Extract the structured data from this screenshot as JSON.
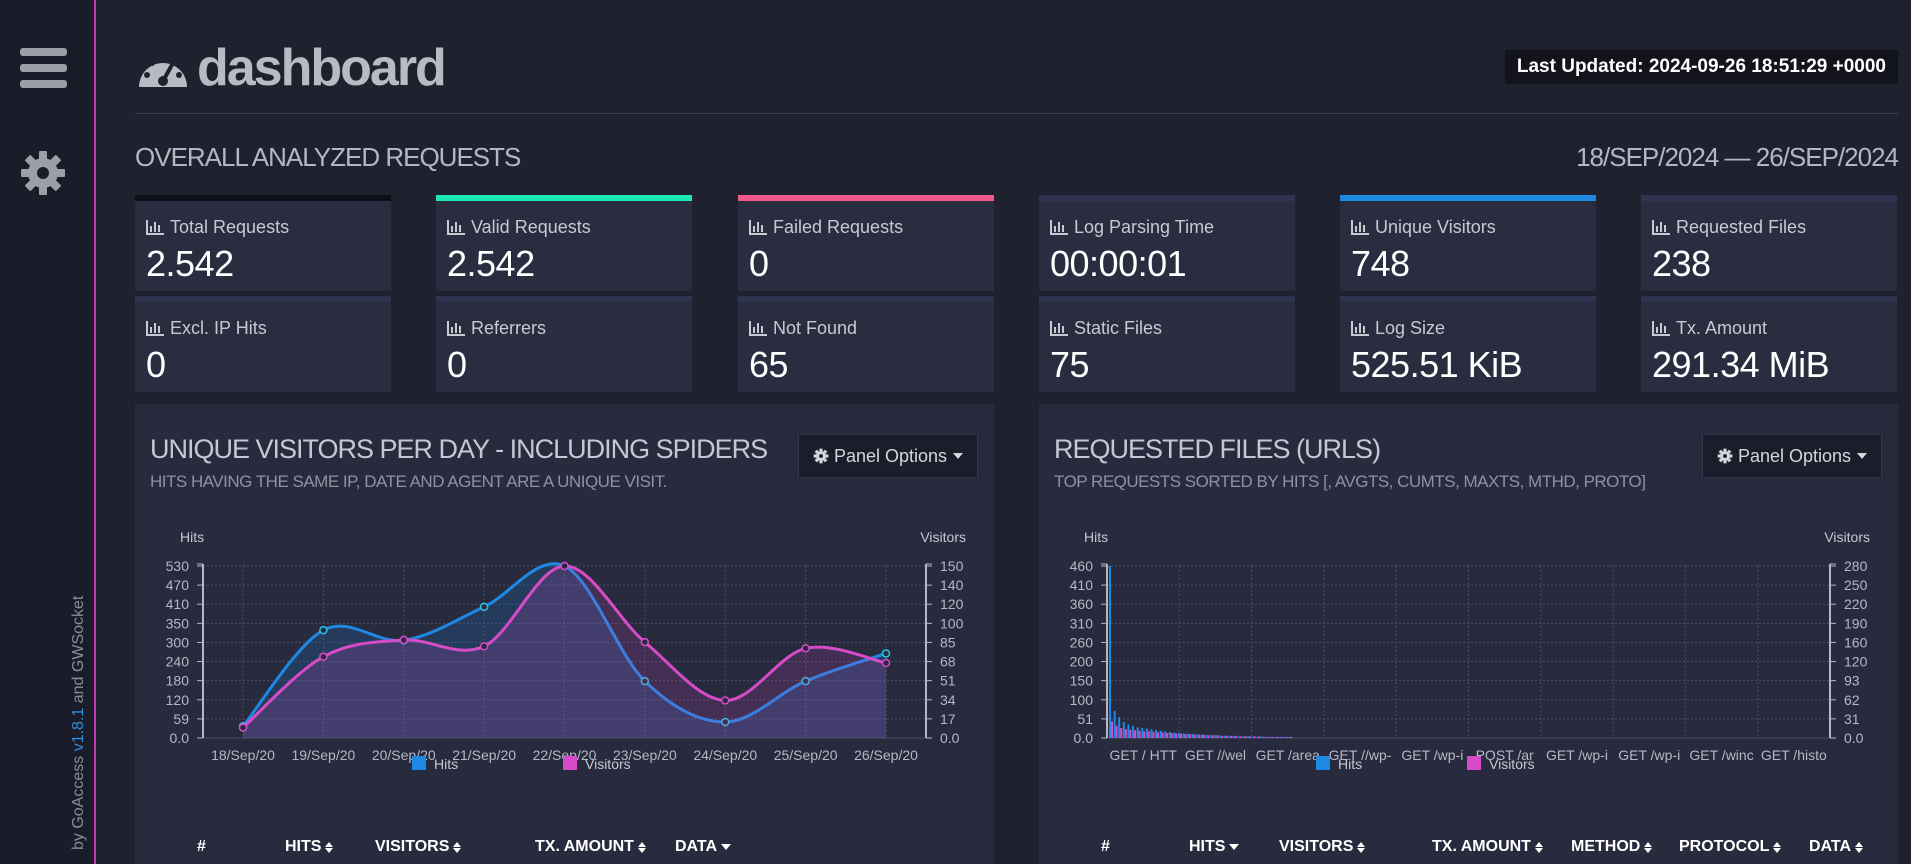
{
  "sidebar": {
    "credit_prefix": "by GoAccess",
    "credit_version": "v1.8.1",
    "credit_and": "and",
    "credit_socket": "GWSocket"
  },
  "header": {
    "title": "dashboard",
    "last_updated": "Last Updated: 2024-09-26 18:51:29 +0000"
  },
  "overall": {
    "title": "OVERALL ANALYZED REQUESTS",
    "date_range": "18/SEP/2024 — 26/SEP/2024",
    "cards": [
      {
        "label": "Total Requests",
        "value": "2.542",
        "accent": "#0f0f17"
      },
      {
        "label": "Valid Requests",
        "value": "2.542",
        "accent": "#1de9b6"
      },
      {
        "label": "Failed Requests",
        "value": "0",
        "accent": "#f0588c"
      },
      {
        "label": "Log Parsing Time",
        "value": "00:00:01",
        "accent": "#2e3350"
      },
      {
        "label": "Unique Visitors",
        "value": "748",
        "accent": "#1e88e5"
      },
      {
        "label": "Requested Files",
        "value": "238",
        "accent": "#2e3350"
      },
      {
        "label": "Excl. IP Hits",
        "value": "0",
        "accent": "#2e3350"
      },
      {
        "label": "Referrers",
        "value": "0",
        "accent": "#2e3350"
      },
      {
        "label": "Not Found",
        "value": "65",
        "accent": "#2e3350"
      },
      {
        "label": "Static Files",
        "value": "75",
        "accent": "#2e3350"
      },
      {
        "label": "Log Size",
        "value": "525.51 KiB",
        "accent": "#2e3350"
      },
      {
        "label": "Tx. Amount",
        "value": "291.34 MiB",
        "accent": "#2e3350"
      }
    ]
  },
  "panels": [
    {
      "title": "UNIQUE VISITORS PER DAY - INCLUDING SPIDERS",
      "subtitle": "HITS HAVING THE SAME IP, DATE AND AGENT ARE A UNIQUE VISIT.",
      "options_label": "Panel Options",
      "columns": [
        "#",
        "HITS",
        "VISITORS",
        "TX. AMOUNT",
        "DATA"
      ]
    },
    {
      "title": "REQUESTED FILES (URLS)",
      "subtitle": "TOP REQUESTS SORTED BY HITS [, AVGTS, CUMTS, MAXTS, MTHD, PROTO]",
      "options_label": "Panel Options",
      "columns": [
        "#",
        "HITS",
        "VISITORS",
        "TX. AMOUNT",
        "METHOD",
        "PROTOCOL",
        "DATA"
      ]
    }
  ],
  "chart_data": [
    {
      "type": "area",
      "ylabel": "Hits",
      "y2label": "Visitors",
      "categories": [
        "18/Sep/20",
        "19/Sep/20",
        "20/Sep/20",
        "21/Sep/20",
        "22/Sep/20",
        "23/Sep/20",
        "24/Sep/20",
        "25/Sep/20",
        "26/Sep/20"
      ],
      "y_ticks": [
        "0.0",
        "59",
        "120",
        "180",
        "240",
        "300",
        "350",
        "410",
        "470",
        "530"
      ],
      "y2_ticks": [
        "0.0",
        "17",
        "34",
        "51",
        "68",
        "85",
        "100",
        "120",
        "140",
        "150"
      ],
      "ylim": [
        0,
        590
      ],
      "y2lim": [
        0,
        165
      ],
      "series": [
        {
          "name": "Hits",
          "color": "#1e88e5",
          "values": [
            40,
            370,
            335,
            450,
            590,
            195,
            55,
            195,
            290
          ]
        },
        {
          "name": "Visitors",
          "color": "#d84bc8",
          "values": [
            10,
            78,
            94,
            88,
            165,
            92,
            36,
            86,
            72
          ]
        }
      ],
      "legend": "bottom"
    },
    {
      "type": "bar",
      "ylabel": "Hits",
      "y2label": "Visitors",
      "categories": [
        "GET / HTT",
        "GET //wel",
        "GET /area",
        "GET //wp-",
        "GET /wp-i",
        "POST /ar",
        "GET /wp-i",
        "GET /wp-i",
        "GET /winc",
        "GET /histo"
      ],
      "y_ticks": [
        "0.0",
        "51",
        "100",
        "150",
        "200",
        "260",
        "310",
        "360",
        "410",
        "460"
      ],
      "y2_ticks": [
        "0.0",
        "31",
        "62",
        "93",
        "120",
        "160",
        "190",
        "220",
        "250",
        "280"
      ],
      "ylim": [
        0,
        510
      ],
      "y2lim": [
        0,
        310
      ],
      "series": [
        {
          "name": "Hits",
          "color": "#1e88e5",
          "values": [
            510,
            80,
            62,
            48,
            40,
            36,
            32,
            30,
            28,
            26,
            24,
            22,
            20,
            18,
            16,
            15,
            14,
            13,
            12,
            11,
            10,
            9,
            8,
            8,
            7,
            7,
            6,
            6,
            5,
            5,
            5,
            4,
            4,
            4,
            4,
            3,
            3,
            3,
            3,
            3
          ]
        },
        {
          "name": "Visitors",
          "color": "#d84bc8",
          "values": [
            30,
            22,
            18,
            16,
            15,
            14,
            13,
            12,
            12,
            11,
            10,
            10,
            9,
            9,
            8,
            8,
            7,
            7,
            6,
            6,
            6,
            5,
            5,
            5,
            4,
            4,
            4,
            4,
            3,
            3,
            3,
            3,
            3,
            2,
            2,
            2,
            2,
            2,
            2,
            2
          ]
        }
      ],
      "legend": "bottom"
    }
  ]
}
